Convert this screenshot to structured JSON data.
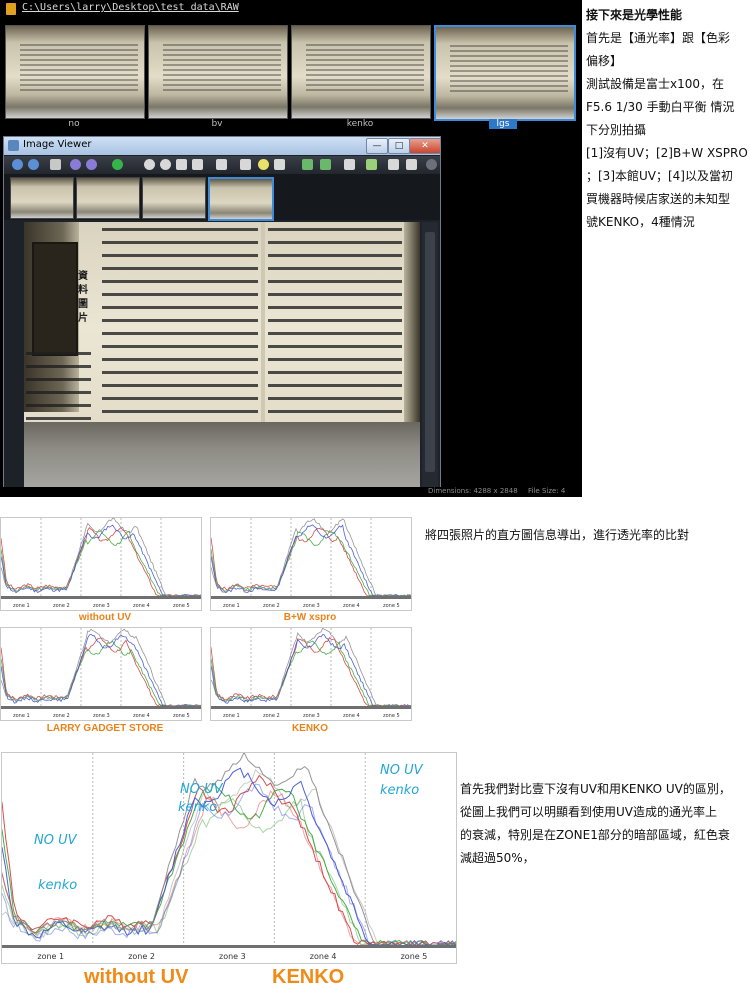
{
  "browser": {
    "path": "C:\\Users\\larry\\Desktop\\test data\\RAW",
    "thumbnails": [
      {
        "label": "no",
        "selected": false
      },
      {
        "label": "bv",
        "selected": false
      },
      {
        "label": "kenko",
        "selected": false
      },
      {
        "label": "lgs",
        "selected": true
      }
    ],
    "status": {
      "dimensions": "Dimensions: 4288 x 2848",
      "filesize": "File Size: 4"
    }
  },
  "viewer": {
    "title": "Image Viewer",
    "minimize": "—",
    "maximize": "□",
    "close": "✕",
    "sidebar_heading": "資料圖片"
  },
  "text_top": {
    "heading": "接下來是光學性能",
    "lines": [
      "首先是【通光率】跟【色彩",
      "偏移】",
      "測試設備是富士x100，在",
      " F5.6 1/30 手動白平衡 情況",
      "下分別拍攝",
      "[1]沒有UV；[2]B+W XSPRO",
      "；[3]本館UV；[4]以及當初",
      "買機器時候店家送的未知型",
      "號KENKO，4種情況"
    ]
  },
  "text_middle": "將四張照片的直方圖信息導出，進行透光率的比對",
  "text_bottom": {
    "lines": [
      "首先我們對比壹下沒有UV和用KENKO UV的區別，",
      "從圖上我們可以明顯看到使用UV造成的通光率上",
      "的衰減，特別是在ZONE1部分的暗部區域，紅色衰",
      "減超過50%，"
    ]
  },
  "histograms": {
    "zones_small": [
      "zone 1",
      "zone 2",
      "zone 3",
      "zone 4",
      "zone 5"
    ],
    "labels": [
      "without UV",
      "B+W xspro",
      "LARRY GADGET STORE",
      "KENKO"
    ],
    "big": {
      "zones": [
        "zone 1",
        "zone 2",
        "zone 3",
        "zone 4",
        "zone 5"
      ],
      "labels": [
        "without UV",
        "KENKO"
      ],
      "annotations": [
        "NO UV",
        "kenko",
        "NO UV",
        "kenko",
        "NO UV",
        "kenko"
      ]
    },
    "colors": {
      "red": "#d43a3a",
      "green": "#3aa53a",
      "blue": "#3a4fd4",
      "gray": "#8a8a8a",
      "orange": "#f08a18",
      "annotation": "#23a6d6"
    }
  }
}
